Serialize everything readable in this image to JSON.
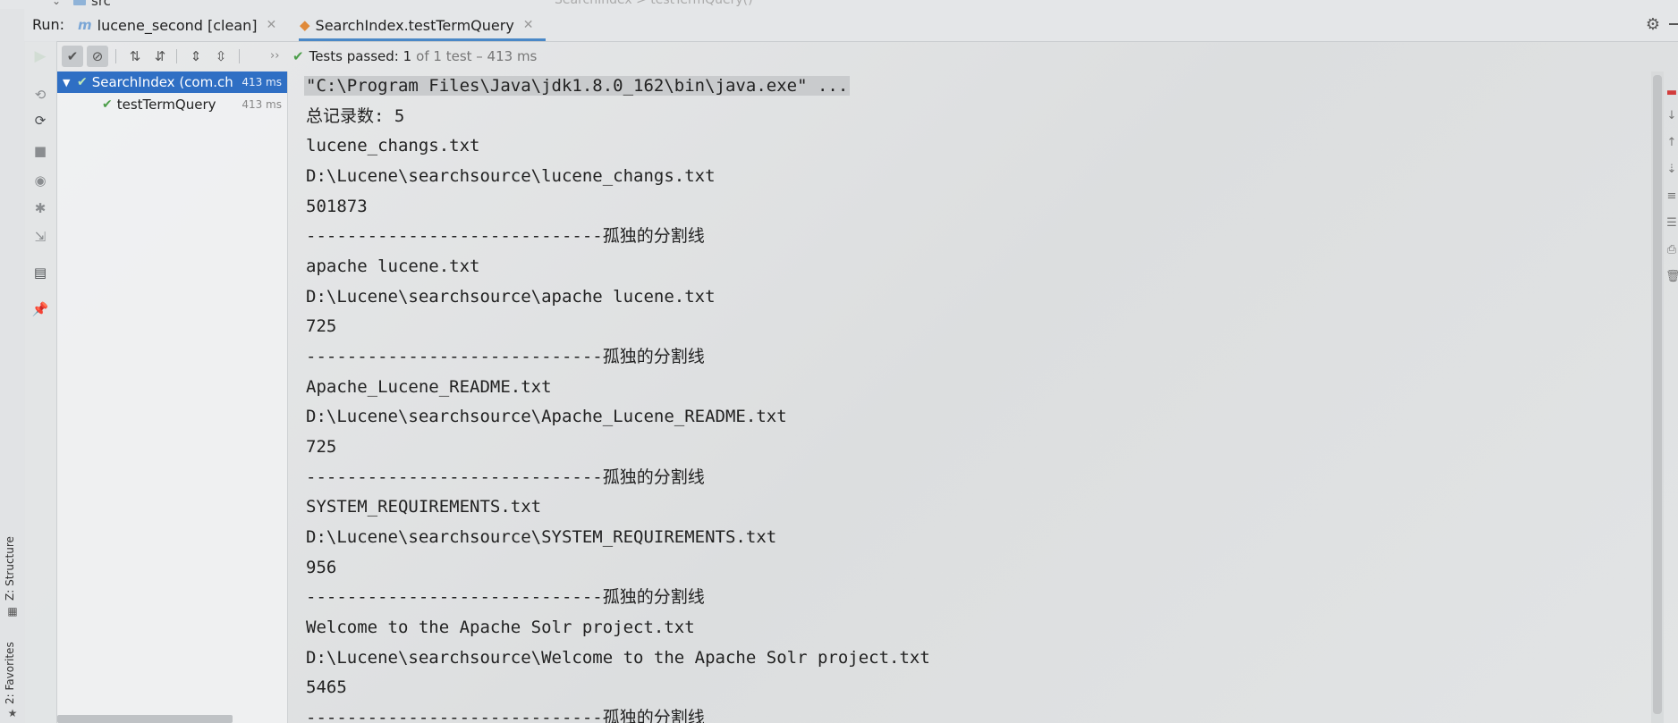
{
  "top": {
    "src_label": "src",
    "ghost_text": "SearchIndex  >  testTermQuery()"
  },
  "run_bar": {
    "label": "Run:",
    "tabs": [
      {
        "label": "lucene_second [clean]",
        "icon": "maven-icon"
      },
      {
        "label": "SearchIndex.testTermQuery",
        "icon": "junit-icon",
        "active": true
      }
    ],
    "accent": "#4a88c7"
  },
  "toolbar": {
    "status_passed": "Tests passed: 1",
    "status_detail": "of 1 test – 413 ms",
    "pass_color": "#4c9e4a"
  },
  "tree": {
    "items": [
      {
        "name": "SearchIndex (com.ch",
        "time": "413 ms",
        "selected": true
      },
      {
        "name": "testTermQuery",
        "time": "413 ms"
      }
    ],
    "selection_color": "#2f6fc4"
  },
  "console": {
    "lines": [
      "\"C:\\Program Files\\Java\\jdk1.8.0_162\\bin\\java.exe\" ...",
      "总记录数: 5",
      "lucene_changs.txt",
      "D:\\Lucene\\searchsource\\lucene_changs.txt",
      "501873",
      "-----------------------------孤独的分割线",
      "apache lucene.txt",
      "D:\\Lucene\\searchsource\\apache lucene.txt",
      "725",
      "-----------------------------孤独的分割线",
      "Apache_Lucene_README.txt",
      "D:\\Lucene\\searchsource\\Apache_Lucene_README.txt",
      "725",
      "-----------------------------孤独的分割线",
      "SYSTEM_REQUIREMENTS.txt",
      "D:\\Lucene\\searchsource\\SYSTEM_REQUIREMENTS.txt",
      "956",
      "-----------------------------孤独的分割线",
      "Welcome to the Apache Solr project.txt",
      "D:\\Lucene\\searchsource\\Welcome to the Apache Solr project.txt",
      "5465",
      "-----------------------------孤独的分割线"
    ]
  },
  "side_tabs": {
    "structure": "Z: Structure",
    "favorites": "2: Favorites"
  }
}
